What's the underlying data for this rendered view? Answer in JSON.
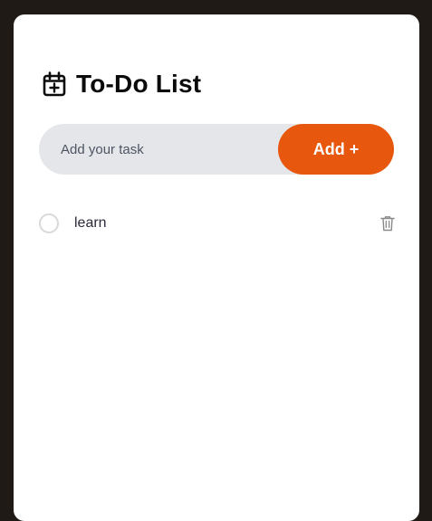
{
  "header": {
    "icon": "calendar-plus-icon",
    "title": "To-Do List"
  },
  "input": {
    "placeholder": "Add your task",
    "value": ""
  },
  "add_button": {
    "label": "Add +"
  },
  "tasks": [
    {
      "text": "learn",
      "completed": false,
      "delete_icon": "trash-icon"
    }
  ],
  "colors": {
    "background": "#1f1a16",
    "card": "#ffffff",
    "input_bg": "#e5e6ea",
    "accent": "#e8570e",
    "checkbox_border": "#d9d9d9",
    "delete_icon": "#8a8a8a"
  }
}
